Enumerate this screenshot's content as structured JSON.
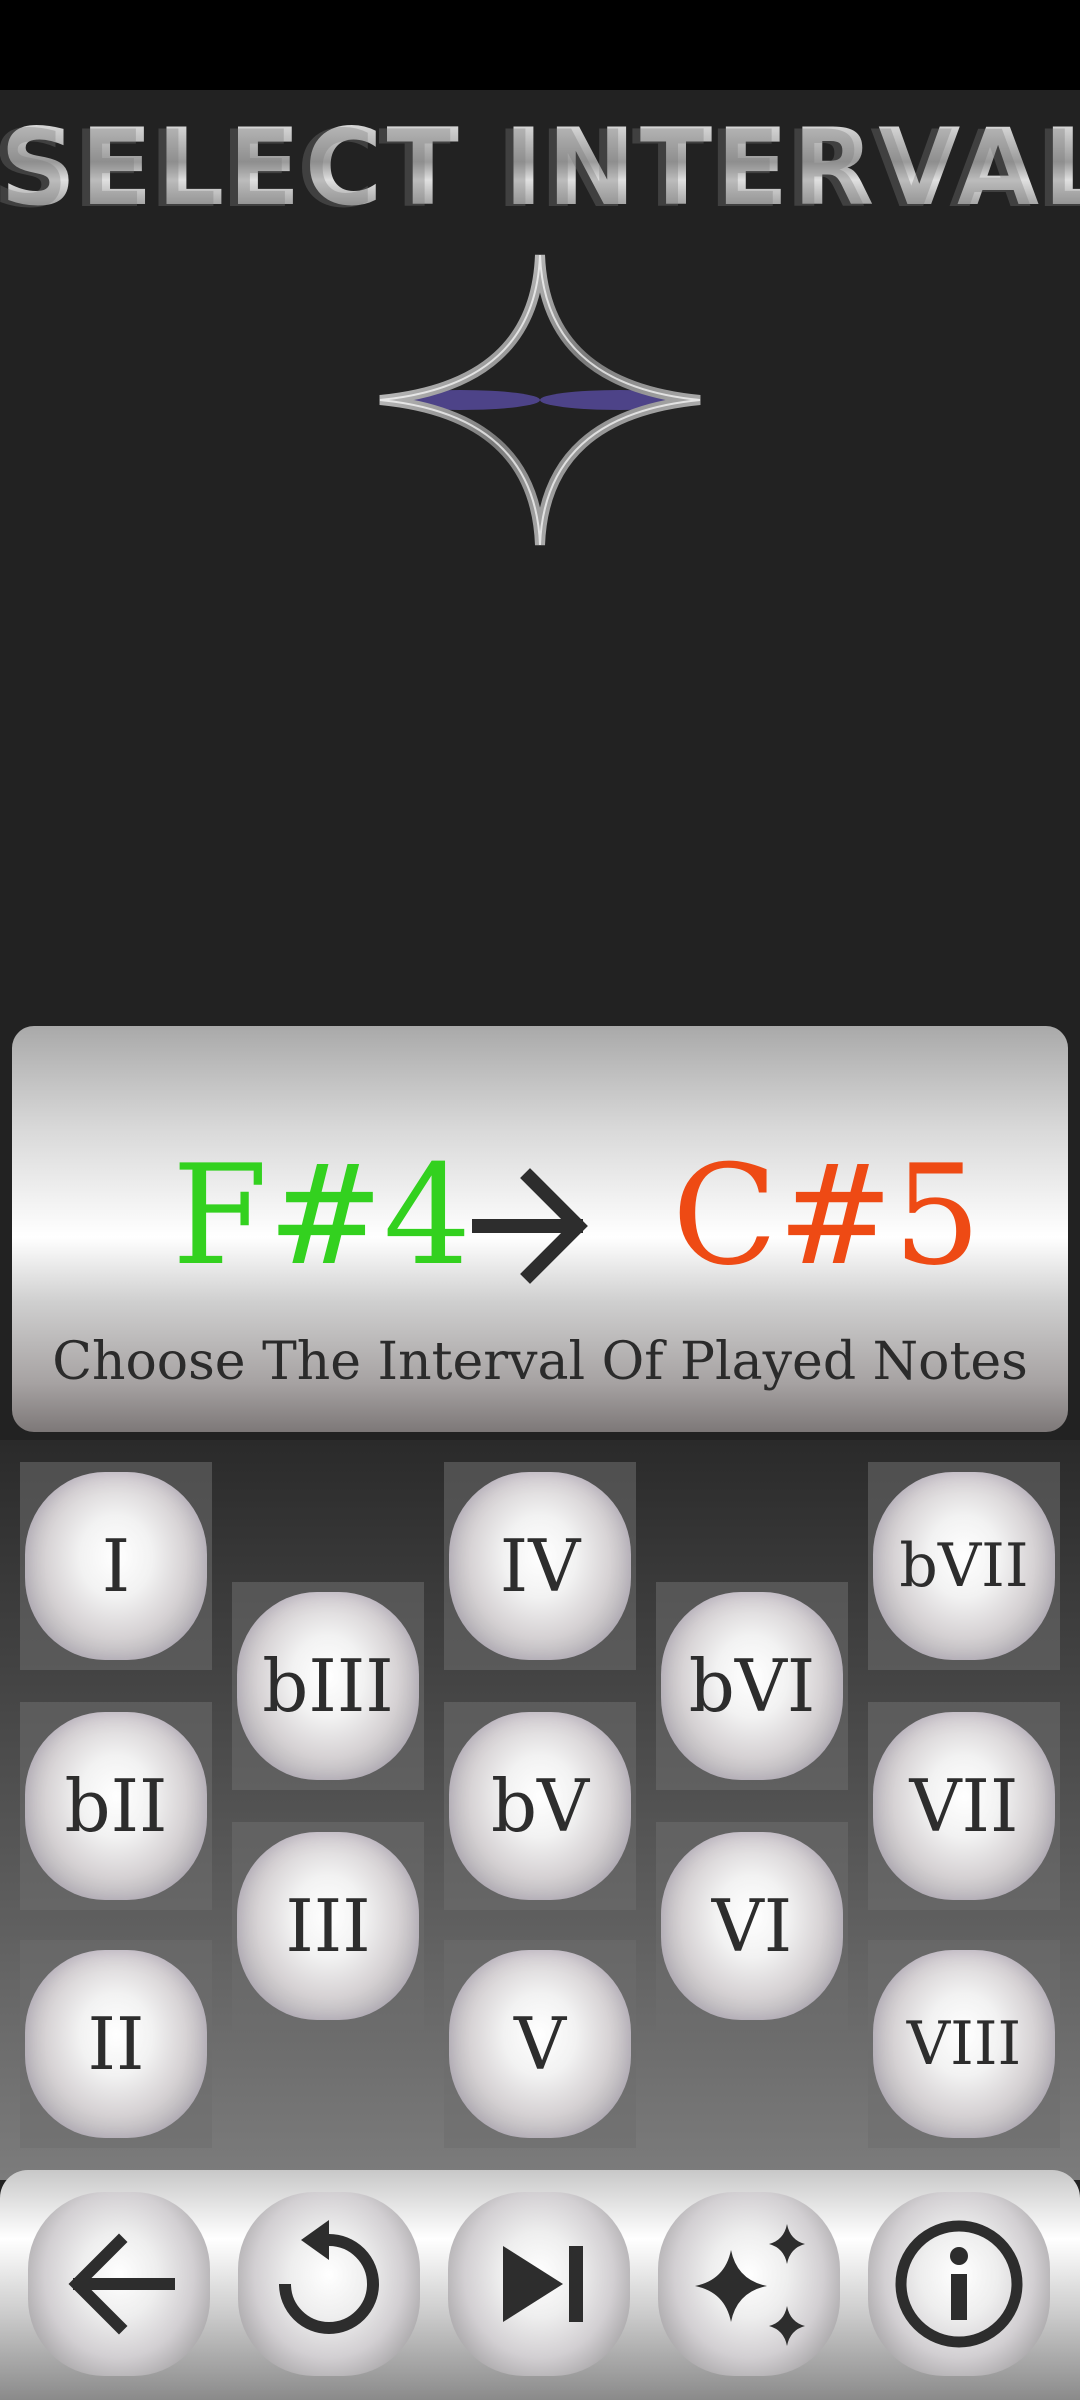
{
  "header": {
    "title": "SELECT INTERVAL"
  },
  "notes": {
    "from": "F#4",
    "to": "C#5",
    "from_color": "#33d11f",
    "to_color": "#ee4a14",
    "instruction": "Choose The Interval Of Played Notes"
  },
  "intervals": {
    "I": "I",
    "bII": "bII",
    "II": "II",
    "bIII": "bIII",
    "III": "III",
    "IV": "IV",
    "bV": "bV",
    "V": "V",
    "bVI": "bVI",
    "VI": "VI",
    "bVII": "bVII",
    "VII": "VII",
    "VIII": "VIII"
  },
  "toolbar": {
    "icons": [
      "back-arrow-icon",
      "replay-icon",
      "skip-next-icon",
      "sparkle-icon",
      "info-icon"
    ]
  }
}
